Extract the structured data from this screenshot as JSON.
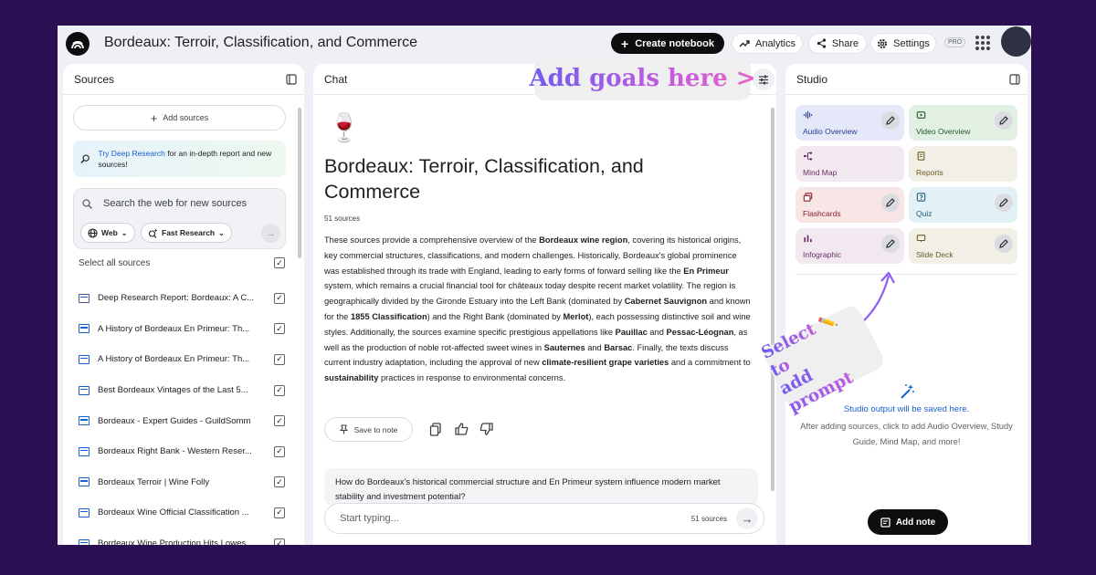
{
  "header": {
    "title": "Bordeaux: Terroir, Classification, and Commerce",
    "create_notebook": "Create notebook",
    "analytics": "Analytics",
    "share": "Share",
    "settings": "Settings",
    "pro_badge": "PRO"
  },
  "sources": {
    "title": "Sources",
    "add_sources": "Add sources",
    "deep_research_link": "Try Deep Research",
    "deep_research_text": "for an in-depth report and new sources!",
    "search_placeholder": "Search the web for new sources",
    "chip_web": "Web",
    "chip_research": "Fast Research",
    "select_all": "Select all sources",
    "items": [
      {
        "name": "Deep Research Report: Bordeaux: A C...",
        "icon": "pdf-doc-icon"
      },
      {
        "name": "A History of Bordeaux En Primeur: Th...",
        "icon": "web-doc-icon"
      },
      {
        "name": "A History of Bordeaux En Primeur: Th...",
        "icon": "web-doc-icon"
      },
      {
        "name": "Best Bordeaux Vintages of the Last 5...",
        "icon": "web-doc-icon"
      },
      {
        "name": "Bordeaux - Expert Guides - GuildSomm",
        "icon": "web-doc-icon"
      },
      {
        "name": "Bordeaux Right Bank - Western Reser...",
        "icon": "web-doc-icon"
      },
      {
        "name": "Bordeaux Terroir | Wine Folly",
        "icon": "web-doc-icon"
      },
      {
        "name": "Bordeaux Wine Official Classification ...",
        "icon": "web-doc-icon"
      },
      {
        "name": "Bordeaux Wine Production Hits Lowes...",
        "icon": "web-doc-icon"
      }
    ]
  },
  "chat": {
    "title": "Chat",
    "emoji": "🍷",
    "notebook_title": "Bordeaux: Terroir, Classification, and Commerce",
    "source_count": "51 sources",
    "summary": {
      "s1": "These sources provide a comprehensive overview of the ",
      "b1": "Bordeaux wine region",
      "s2": ", covering its historical origins, key commercial structures, classifications, and modern challenges. Historically, Bordeaux's global prominence was established through its trade with England, leading to early forms of forward selling like the ",
      "b2": "En Primeur",
      "s3": " system, which remains a crucial financial tool for châteaux today despite recent market volatility. The region is geographically divided by the Gironde Estuary into the Left Bank (dominated by ",
      "b3": "Cabernet Sauvignon",
      "s4": " and known for the ",
      "b4": "1855 Classification",
      "s5": ") and the Right Bank (dominated by ",
      "b5": "Merlot",
      "s6": "), each possessing distinctive soil and wine styles. Additionally, the sources examine specific prestigious appellations like ",
      "b6": "Pauillac",
      "s7": " and ",
      "b7": "Pessac-Léognan",
      "s8": ", as well as the production of noble rot-affected sweet wines in ",
      "b8": "Sauternes",
      "s9": " and ",
      "b9": "Barsac",
      "s10": ". Finally, the texts discuss current industry adaptation, including the approval of new ",
      "b10": "climate-resilient grape varieties",
      "s11": " and a commitment to ",
      "b11": "sustainability",
      "s12": " practices in response to environmental concerns."
    },
    "save_to_note": "Save to note",
    "question": "How do Bordeaux's historical commercial structure and En Primeur system influence modern market stability and investment potential?",
    "input_placeholder": "Start typing...",
    "input_source_count": "51 sources"
  },
  "studio": {
    "title": "Studio",
    "tiles": [
      {
        "label": "Audio Overview",
        "bg": "#e4e8f8",
        "fg": "#2b3a8f",
        "icon": "audio-waves-icon",
        "edit": true
      },
      {
        "label": "Video Overview",
        "bg": "#e2efe3",
        "fg": "#1e5a2a",
        "icon": "video-icon",
        "edit": true
      },
      {
        "label": "Mind Map",
        "bg": "#f1e8f0",
        "fg": "#6b2f66",
        "icon": "mind-map-icon",
        "edit": false
      },
      {
        "label": "Reports",
        "bg": "#f1efe6",
        "fg": "#6a5d22",
        "icon": "reports-icon",
        "edit": false
      },
      {
        "label": "Flashcards",
        "bg": "#f8e6e6",
        "fg": "#8a1f2a",
        "icon": "flashcards-icon",
        "edit": true
      },
      {
        "label": "Quiz",
        "bg": "#e2f1f6",
        "fg": "#1f5c7a",
        "icon": "quiz-icon",
        "edit": true
      },
      {
        "label": "Infographic",
        "bg": "#f1e8f0",
        "fg": "#6b2f66",
        "icon": "infographic-icon",
        "edit": true
      },
      {
        "label": "Slide Deck",
        "bg": "#f1efe6",
        "fg": "#6a5d22",
        "icon": "slide-deck-icon",
        "edit": true
      }
    ],
    "output_title": "Studio output will be saved here.",
    "output_body": "After adding sources, click to add Audio Overview, Study Guide, Mind Map, and more!",
    "add_note": "Add note"
  },
  "annotations": {
    "goals": "Add goals here >",
    "select_line1": "Select",
    "select_line2": "to",
    "select_line3": "add prompt"
  },
  "colors": {
    "page_bg": "#2a0f52",
    "app_bg": "#eef0f5",
    "accent_blue": "#1a5fd0",
    "callout_gradient_start": "#6d5cf0",
    "callout_gradient_end": "#e563c9"
  }
}
